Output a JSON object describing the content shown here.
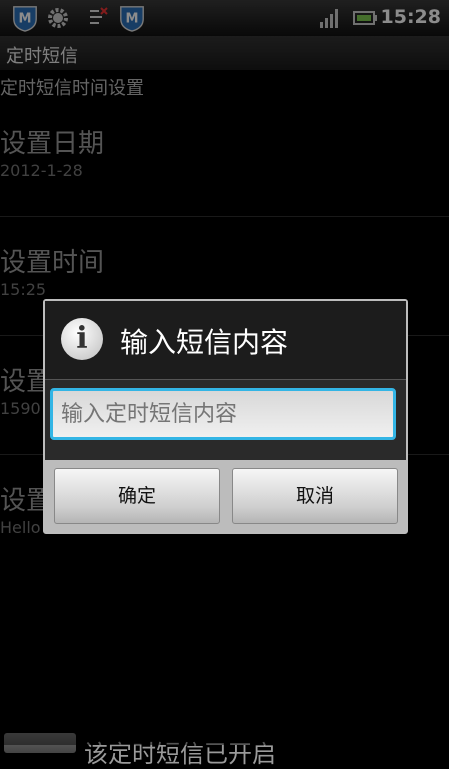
{
  "status_bar": {
    "icons": [
      "mcafee-icon",
      "settings-gear-icon",
      "usb-debug-icon",
      "mcafee-shield-icon",
      "signal-icon",
      "battery-icon"
    ],
    "clock": "15:28"
  },
  "app": {
    "title": "定时短信"
  },
  "settings": {
    "category": "定时短信时间设置",
    "items": [
      {
        "title": "设置日期",
        "summary": "2012-1-28"
      },
      {
        "title": "设置时间",
        "summary": "15:25"
      },
      {
        "title": "设置",
        "summary": "1590"
      },
      {
        "title": "设置",
        "summary": "Hello Lilece"
      }
    ],
    "bottom_text": "该定时短信已开启"
  },
  "dialog": {
    "title": "输入短信内容",
    "input_placeholder": "输入定时短信内容",
    "ok_label": "确定",
    "cancel_label": "取消"
  },
  "colors": {
    "accent": "#33b5e5"
  }
}
